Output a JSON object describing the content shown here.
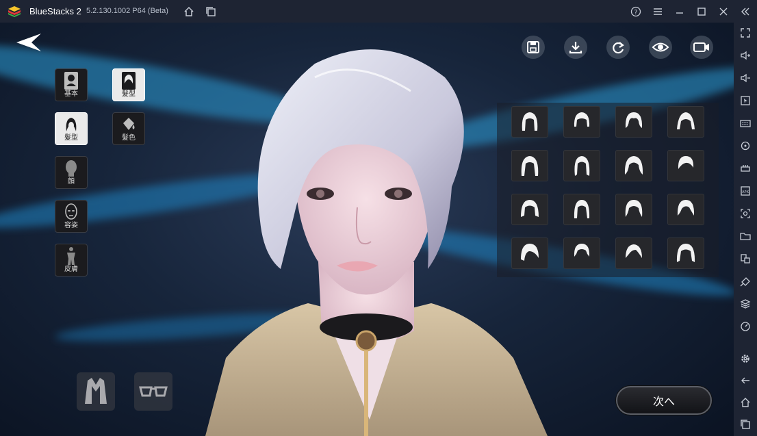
{
  "titlebar": {
    "app_name": "BlueStacks 2",
    "version": "5.2.130.1002 P64 (Beta)",
    "icons": [
      "home-icon",
      "multi-instance-icon",
      "help-icon",
      "menu-icon",
      "minimize-icon",
      "maximize-icon",
      "close-icon",
      "collapse-sidebar-icon"
    ]
  },
  "sidebar": {
    "icons": [
      "fullscreen-icon",
      "volume-up-icon",
      "volume-down-icon",
      "pointer-icon",
      "keyboard-icon",
      "rotate-icon",
      "macro-icon",
      "apk-icon",
      "screenshot-icon",
      "folder-icon",
      "multi-window-icon",
      "eco-mode-icon",
      "layers-icon",
      "performance-icon",
      "settings-icon",
      "back-icon",
      "home-icon",
      "recent-apps-icon"
    ]
  },
  "game": {
    "top_tools": [
      "save-icon",
      "download-icon",
      "reset-icon",
      "view-icon",
      "camera-icon"
    ],
    "categories": [
      {
        "id": "basic",
        "label": "基本"
      },
      {
        "id": "hairstyle-tab",
        "label": "髮型"
      },
      {
        "id": "hairstyle",
        "label": "髮型"
      },
      {
        "id": "hair-color",
        "label": "髮色"
      },
      {
        "id": "face",
        "label": "顔"
      },
      {
        "id": "makeup",
        "label": "容姿"
      },
      {
        "id": "skin",
        "label": "皮膚"
      }
    ],
    "hair_options_count_label": "16",
    "bottom_buttons": [
      "coat-icon",
      "glasses-icon"
    ],
    "next_label": "次へ"
  },
  "colors": {
    "titlebar_bg": "#1e2433",
    "accent": "#2e9fd8"
  }
}
